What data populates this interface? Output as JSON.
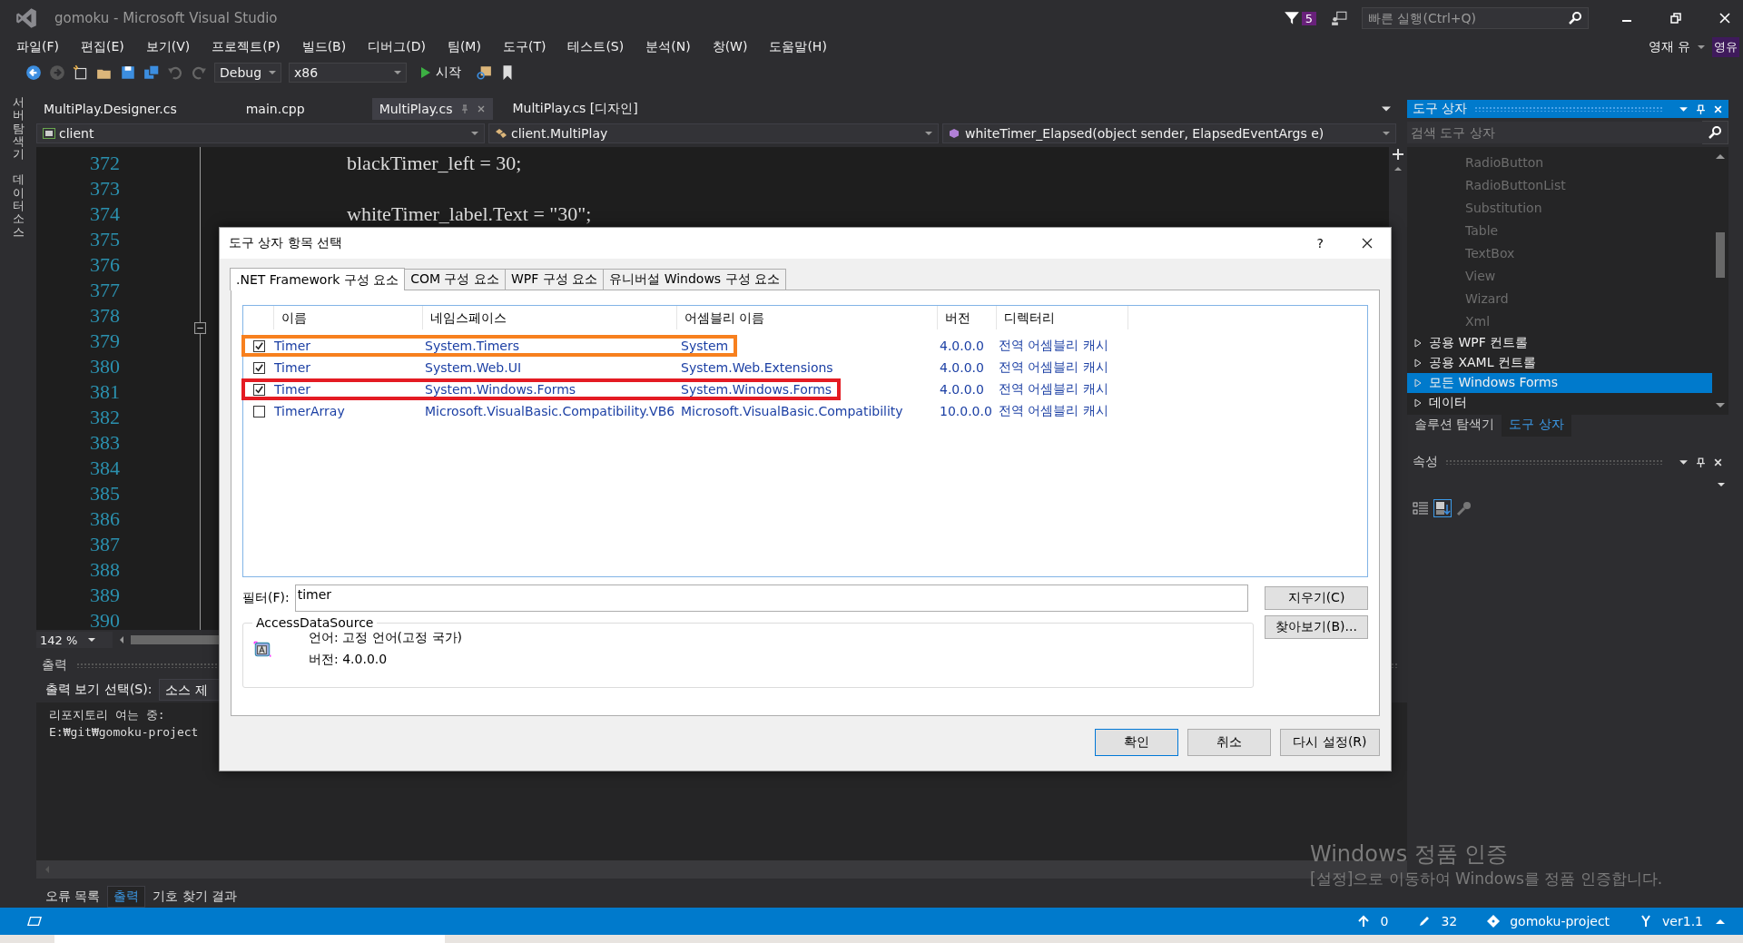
{
  "window": {
    "title": "gomoku - Microsoft Visual Studio",
    "notification_count": "5",
    "quick_launch": {
      "placeholder": "빠른 실행(Ctrl+Q)"
    },
    "user": "영재 유",
    "user_initials": "영유"
  },
  "menu": [
    "파일(F)",
    "편집(E)",
    "보기(V)",
    "프로젝트(P)",
    "빌드(B)",
    "디버그(D)",
    "팀(M)",
    "도구(T)",
    "테스트(S)",
    "분석(N)",
    "창(W)",
    "도움말(H)"
  ],
  "toolbar": {
    "configuration": "Debug",
    "platform": "x86",
    "start": "시작"
  },
  "side_tabs": [
    "서버 탐색기",
    "데이터 소스"
  ],
  "doc_tabs": [
    {
      "label": "MultiPlay.Designer.cs",
      "selected": false
    },
    {
      "label": "main.cpp",
      "selected": false
    },
    {
      "label": "MultiPlay.cs",
      "selected": true
    },
    {
      "label": "MultiPlay.cs [디자인]",
      "selected": false
    }
  ],
  "nav_bar": [
    "client",
    "client.MultiPlay",
    "whiteTimer_Elapsed(object sender, ElapsedEventArgs e)"
  ],
  "editor": {
    "zoom": "142 %",
    "lines": [
      {
        "number": "372",
        "code": "blackTimer_left = 30;"
      },
      {
        "number": "373"
      },
      {
        "number": "374",
        "code": "whiteTimer_label.Text = \"30\";"
      },
      {
        "number": "375"
      },
      {
        "number": "376"
      },
      {
        "number": "377"
      },
      {
        "number": "378"
      },
      {
        "number": "379"
      },
      {
        "number": "380"
      },
      {
        "number": "381"
      },
      {
        "number": "382"
      },
      {
        "number": "383"
      },
      {
        "number": "384"
      },
      {
        "number": "385"
      },
      {
        "number": "386"
      },
      {
        "number": "387"
      },
      {
        "number": "388"
      },
      {
        "number": "389"
      },
      {
        "number": "390"
      }
    ]
  },
  "output": {
    "title": "출력",
    "source_label": "출력 보기 선택(S):",
    "source": "소스 제",
    "lines": [
      "리포지토리 여는 중:",
      "E:₩git₩gomoku-project"
    ]
  },
  "bottom_tabs": [
    {
      "label": "오류 목록",
      "selected": false
    },
    {
      "label": "출력",
      "selected": true
    },
    {
      "label": "기호 찾기 결과",
      "selected": false
    }
  ],
  "toolbox": {
    "title": "도구 상자",
    "search": {
      "placeholder": "검색 도구 상자"
    },
    "items": [
      {
        "label": "RadioButton",
        "kind": "item"
      },
      {
        "label": "RadioButtonList",
        "kind": "item"
      },
      {
        "label": "Substitution",
        "kind": "item"
      },
      {
        "label": "Table",
        "kind": "item"
      },
      {
        "label": "TextBox",
        "kind": "item"
      },
      {
        "label": "View",
        "kind": "item"
      },
      {
        "label": "Wizard",
        "kind": "item"
      },
      {
        "label": "Xml",
        "kind": "item"
      },
      {
        "label": "공용 WPF 컨트롤",
        "kind": "group",
        "selected": false
      },
      {
        "label": "공용 XAML 컨트롤",
        "kind": "group",
        "selected": false
      },
      {
        "label": "모든 Windows Forms",
        "kind": "group",
        "selected": true
      },
      {
        "label": "데이터",
        "kind": "group",
        "selected": false
      }
    ]
  },
  "panel_tabs": [
    {
      "label": "솔루션 탐색기",
      "selected": false
    },
    {
      "label": "도구 상자",
      "selected": true
    }
  ],
  "properties": {
    "title": "속성"
  },
  "dialog": {
    "title": "도구 상자 항목 선택",
    "help": "?",
    "tabs": [
      {
        "label": ".NET Framework 구성 요소",
        "selected": true
      },
      {
        "label": "COM 구성 요소",
        "selected": false
      },
      {
        "label": "WPF 구성 요소",
        "selected": false
      },
      {
        "label": "유니버설 Windows 구성 요소",
        "selected": false
      }
    ],
    "columns": [
      "이름",
      "네임스페이스",
      "어셈블리 이름",
      "버전",
      "디렉터리"
    ],
    "rows": [
      {
        "checked": true,
        "name": "Timer",
        "namespace": "System.Timers",
        "assembly": "System",
        "version": "4.0.0.0",
        "directory": "전역 어셈블리 캐시",
        "color": "#f7801e"
      },
      {
        "checked": true,
        "name": "Timer",
        "namespace": "System.Web.UI",
        "assembly": "System.Web.Extensions",
        "version": "4.0.0.0",
        "directory": "전역 어셈블리 캐시"
      },
      {
        "checked": true,
        "name": "Timer",
        "namespace": "System.Windows.Forms",
        "assembly": "System.Windows.Forms",
        "version": "4.0.0.0",
        "directory": "전역 어셈블리 캐시",
        "color": "#e41b23"
      },
      {
        "checked": false,
        "name": "TimerArray",
        "namespace": "Microsoft.VisualBasic.Compatibility.VB6",
        "assembly": "Microsoft.VisualBasic.Compatibility",
        "version": "10.0.0.0",
        "directory": "전역 어셈블리 캐시"
      }
    ],
    "filter": {
      "label": "필터(F):",
      "value": "timer"
    },
    "clear_button": "지우기(C)",
    "browse_button": "찾아보기(B)...",
    "info": {
      "title": "AccessDataSource",
      "language": "언어: 고정 언어(고정 국가)",
      "version": "버전: 4.0.0.0"
    },
    "buttons": [
      {
        "label": "확인",
        "kind": "default"
      },
      {
        "label": "취소",
        "kind": "normal"
      },
      {
        "label": "다시 설정(R)",
        "kind": "normal"
      }
    ]
  },
  "status_bar": {
    "pushes": "0",
    "changes": "32",
    "repository": "gomoku-project",
    "branch": "ver1.1"
  },
  "activation": {
    "title": "Windows 정품 인증",
    "text": "[설정]으로 이동하여 Windows를 정품 인증합니다."
  }
}
